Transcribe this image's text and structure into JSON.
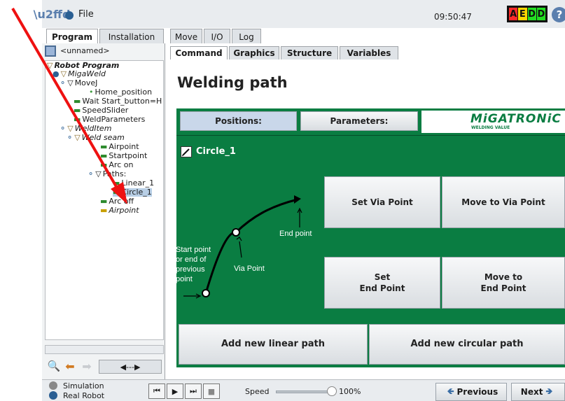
{
  "header": {
    "file_label": "File",
    "clock": "09:50:47",
    "status_letters": [
      {
        "letter": "A",
        "color": "#ff2a2a"
      },
      {
        "letter": "E",
        "color": "#ffd700"
      },
      {
        "letter": "D",
        "color": "#22dd22"
      },
      {
        "letter": "D",
        "color": "#22dd22"
      }
    ],
    "help_glyph": "?"
  },
  "main_tabs": [
    "Program",
    "Installation",
    "Move",
    "I/O",
    "Log"
  ],
  "program": {
    "name": "<unnamed>",
    "tree": [
      {
        "label": "Robot Program"
      },
      {
        "label": "MigaWeld"
      },
      {
        "label": "MoveJ"
      },
      {
        "label": "Home_position"
      },
      {
        "label": "Wait Start_button=H"
      },
      {
        "label": "SpeedSlider"
      },
      {
        "label": "WeldParameters"
      },
      {
        "label": "WeldItem"
      },
      {
        "label": "Weld seam"
      },
      {
        "label": "Airpoint"
      },
      {
        "label": "Startpoint"
      },
      {
        "label": "Arc on"
      },
      {
        "label": "Paths:"
      },
      {
        "label": "Linear_1"
      },
      {
        "label": "Circle_1"
      },
      {
        "label": "Arc off"
      },
      {
        "label": "Airpoint"
      }
    ],
    "move_tool_label": "◀---▶"
  },
  "sub_tabs": [
    "Command",
    "Graphics",
    "Structure",
    "Variables"
  ],
  "command": {
    "title": "Welding path",
    "positions_label": "Positions:",
    "parameters_label": "Parameters:",
    "logo_main": "MiGATRONiC",
    "logo_sub": "WELDING VALUE",
    "node_name": "Circle_1",
    "diagram": {
      "start_label": "Start point\nor end of\nprevious\npoint",
      "via_label": "Via Point",
      "end_label": "End point"
    },
    "set_via_label": "Set Via Point",
    "move_via_label": "Move to Via Point",
    "set_end_label": "Set\nEnd Point",
    "move_end_label": "Move to\nEnd Point",
    "add_linear_label": "Add new linear path",
    "add_circular_label": "Add new circular path"
  },
  "footer": {
    "simulation_label": "Simulation",
    "real_robot_label": "Real Robot",
    "speed_label": "Speed",
    "speed_value": "100%",
    "speed_fraction": 1.0,
    "previous_label": "Previous",
    "next_label": "Next"
  },
  "colors": {
    "panel_green": "#0a7d42",
    "annotation_arrow": "#ee1111"
  }
}
